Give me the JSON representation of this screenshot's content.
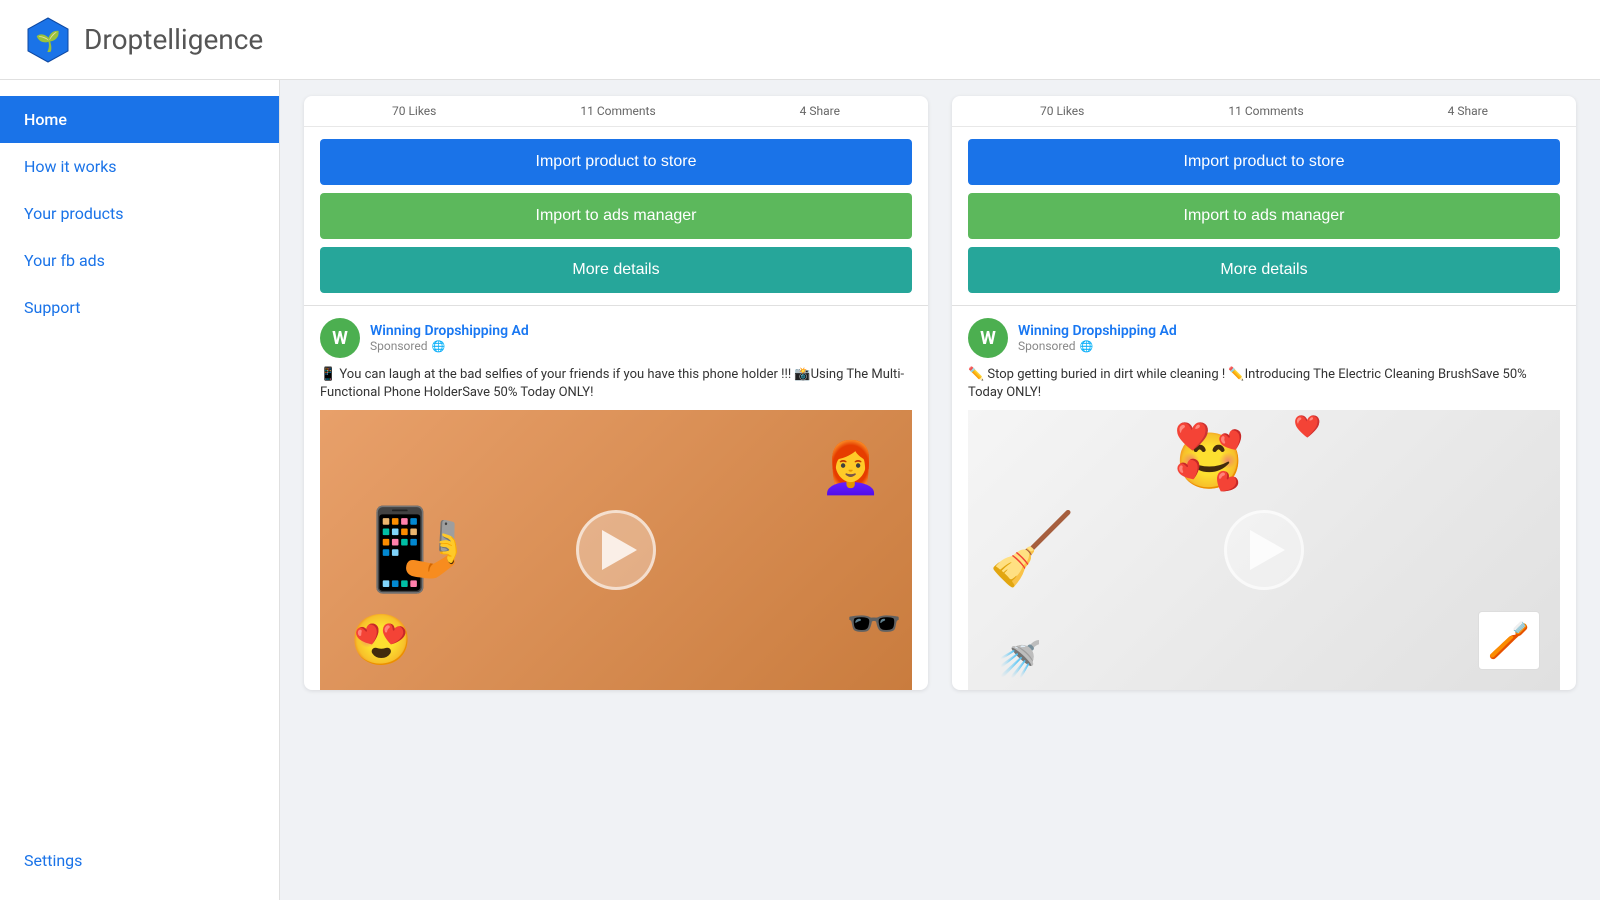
{
  "header": {
    "logo_text": "Droptelligence"
  },
  "sidebar": {
    "items": [
      {
        "id": "home",
        "label": "Home",
        "active": true
      },
      {
        "id": "how-it-works",
        "label": "How it works",
        "active": false
      },
      {
        "id": "your-products",
        "label": "Your products",
        "active": false
      },
      {
        "id": "your-fb-ads",
        "label": "Your fb ads",
        "active": false
      },
      {
        "id": "support",
        "label": "Support",
        "active": false
      },
      {
        "id": "settings",
        "label": "Settings",
        "active": false
      }
    ]
  },
  "cards": [
    {
      "id": "card-1",
      "stats": {
        "likes": "70 Likes",
        "comments": "11 Comments",
        "share": "4 Share"
      },
      "buttons": {
        "import_store": "Import product to store",
        "import_ads": "Import to ads manager",
        "more_details": "More details"
      },
      "ad": {
        "page_name": "Winning Dropshipping Ad",
        "sponsored": "Sponsored",
        "text": "📱 You can laugh at the bad selfies of your friends if you have this phone holder !!! 📸Using The Multi-Functional Phone HolderSave 50% Today ONLY!",
        "image_type": "phone"
      }
    },
    {
      "id": "card-2",
      "stats": {
        "likes": "70 Likes",
        "comments": "11 Comments",
        "share": "4 Share"
      },
      "buttons": {
        "import_store": "Import product to store",
        "import_ads": "Import to ads manager",
        "more_details": "More details"
      },
      "ad": {
        "page_name": "Winning Dropshipping Ad",
        "sponsored": "Sponsored",
        "text": "✏️ Stop getting buried in dirt while cleaning ! ✏️Introducing The Electric Cleaning BrushSave 50% Today ONLY!",
        "image_type": "brush"
      }
    }
  ],
  "colors": {
    "blue": "#1a73e8",
    "green": "#5cb85c",
    "teal": "#26a69a",
    "sidebar_active_bg": "#1a73e8"
  }
}
